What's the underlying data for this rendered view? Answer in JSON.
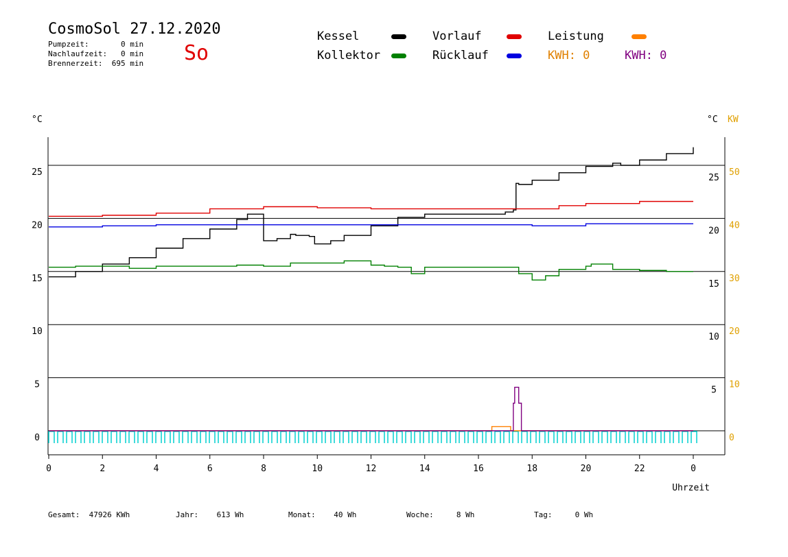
{
  "header": {
    "title": "CosmoSol 27.12.2020",
    "day": "So",
    "pumpzeit": "Pumpzeit:       0 min",
    "nachlaufzeit": "Nachlaufzeit:   0 min",
    "brennerzeit": "Brennerzeit:  695 min"
  },
  "legend": {
    "kessel": "Kessel",
    "kollektor": "Kollektor",
    "vorlauf": "Vorlauf",
    "ruecklauf": "Rücklauf",
    "leistung": "Leistung",
    "kwh1": "KWH: 0",
    "kwh2": "KWH: 0"
  },
  "colors": {
    "kessel": "#000000",
    "kollektor": "#008000",
    "vorlauf": "#e00000",
    "ruecklauf": "#0000e0",
    "leistung": "#ff8000",
    "kwh2": "#800080",
    "pump": "#00d0d0",
    "kw_axis": "#e0a000"
  },
  "footer": {
    "gesamt": "Gesamt:  47926 KWh",
    "jahr": "Jahr:    613 Wh",
    "monat": "Monat:    40 Wh",
    "woche": "Woche:     8 Wh",
    "tag": "Tag:     0 Wh"
  },
  "chart_data": {
    "type": "line",
    "xlabel": "Uhrzeit",
    "ylabel_left": "°C",
    "ylabel_right": "°C",
    "ylabel_right2": "KW",
    "xlim": [
      0,
      24
    ],
    "ylim": [
      -1.5,
      28
    ],
    "x_ticks": [
      0,
      2,
      4,
      6,
      8,
      10,
      12,
      14,
      16,
      18,
      20,
      22,
      24
    ],
    "x_tick_labels": [
      "0",
      "2",
      "4",
      "6",
      "8",
      "10",
      "12",
      "14",
      "16",
      "18",
      "20",
      "22",
      "0"
    ],
    "left_ticks": [
      0,
      5,
      10,
      15,
      20,
      25
    ],
    "left_tick_labels": [
      "0",
      "5",
      "10",
      "15",
      "20",
      "25"
    ],
    "right_ticks": [
      5,
      10,
      15,
      20,
      25
    ],
    "right_tick_labels": [
      "5",
      "10",
      "15",
      "20",
      "25"
    ],
    "kw_ticks": [
      0,
      5,
      10,
      15,
      20,
      25
    ],
    "kw_tick_labels": [
      "0",
      "10",
      "20",
      "30",
      "40",
      "50"
    ],
    "grid": true,
    "series": [
      {
        "name": "Kessel",
        "color": "#000000",
        "x": [
          0,
          1,
          2,
          3,
          4,
          5,
          6,
          7,
          7.4,
          7.8,
          8.0,
          8.5,
          9.0,
          9.2,
          9.5,
          9.7,
          9.9,
          10.5,
          11,
          12,
          13,
          14,
          15,
          16,
          16.8,
          17.0,
          17.3,
          17.4,
          17.5,
          18,
          19,
          20,
          21,
          21.3,
          22,
          23,
          24
        ],
        "y": [
          14.5,
          15,
          15.7,
          16.3,
          17.2,
          18.1,
          19,
          19.9,
          20.4,
          20.4,
          17.9,
          18.1,
          18.5,
          18.4,
          18.4,
          18.3,
          17.6,
          17.9,
          18.4,
          19.3,
          20.1,
          20.4,
          20.4,
          20.4,
          20.4,
          20.6,
          20.8,
          23.3,
          23.2,
          23.6,
          24.3,
          24.9,
          25.2,
          25,
          25.5,
          26.1,
          26.7
        ]
      },
      {
        "name": "Vorlauf",
        "color": "#e00000",
        "x": [
          0,
          2,
          4,
          6,
          8,
          10,
          12,
          14,
          16,
          17,
          18,
          19,
          20,
          22,
          24
        ],
        "y": [
          20.2,
          20.3,
          20.5,
          20.9,
          21.1,
          21.0,
          20.9,
          20.9,
          20.9,
          20.9,
          20.9,
          21.2,
          21.4,
          21.6,
          21.6
        ]
      },
      {
        "name": "Rücklauf",
        "color": "#0000e0",
        "x": [
          0,
          2,
          4,
          6,
          8,
          10,
          12,
          14,
          16,
          18,
          20,
          22,
          24
        ],
        "y": [
          19.2,
          19.3,
          19.4,
          19.4,
          19.4,
          19.4,
          19.4,
          19.4,
          19.4,
          19.3,
          19.5,
          19.5,
          19.5
        ]
      },
      {
        "name": "Kollektor",
        "color": "#008000",
        "x": [
          0,
          1,
          2,
          3,
          4,
          5,
          6,
          7,
          8,
          9,
          10,
          11,
          12,
          12.5,
          13,
          13.5,
          14,
          15,
          16,
          17,
          17.5,
          18,
          18.5,
          19,
          20,
          20.2,
          21,
          22,
          23,
          24
        ],
        "y": [
          15.4,
          15.5,
          15.5,
          15.3,
          15.5,
          15.5,
          15.5,
          15.6,
          15.5,
          15.8,
          15.8,
          16,
          15.6,
          15.5,
          15.4,
          14.8,
          15.4,
          15.4,
          15.4,
          15.4,
          14.8,
          14.2,
          14.6,
          15.2,
          15.5,
          15.7,
          15.2,
          15.1,
          15,
          15
        ]
      },
      {
        "name": "Leistung",
        "color": "#ff8000",
        "x": [
          0,
          16.5,
          16.5,
          17.2,
          17.2,
          24
        ],
        "y": [
          0,
          0,
          0.4,
          0.4,
          0,
          0
        ]
      },
      {
        "name": "KWH",
        "color": "#800080",
        "x": [
          0,
          17.2,
          17.3,
          17.35,
          17.45,
          17.5,
          17.6,
          24
        ],
        "y": [
          0,
          0,
          2.6,
          4.1,
          4.1,
          2.6,
          0,
          0
        ]
      }
    ]
  }
}
